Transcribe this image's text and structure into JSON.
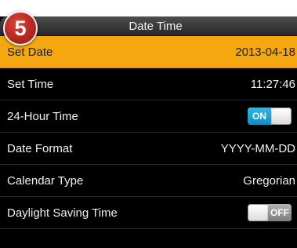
{
  "step_badge": "5",
  "header": {
    "title": "Date Time"
  },
  "rows": [
    {
      "label": "Set Date",
      "value": "2013-04-18"
    },
    {
      "label": "Set Time",
      "value": "11:27:46"
    },
    {
      "label": "24-Hour Time",
      "toggle": "ON"
    },
    {
      "label": "Date Format",
      "value": "YYYY-MM-DD"
    },
    {
      "label": "Calendar Type",
      "value": "Gregorian"
    },
    {
      "label": "Daylight Saving Time",
      "toggle": "OFF"
    }
  ],
  "colors": {
    "selected_row": "#f4a70f",
    "toggle_on": "#1ea6d8",
    "badge": "#b3251d"
  }
}
